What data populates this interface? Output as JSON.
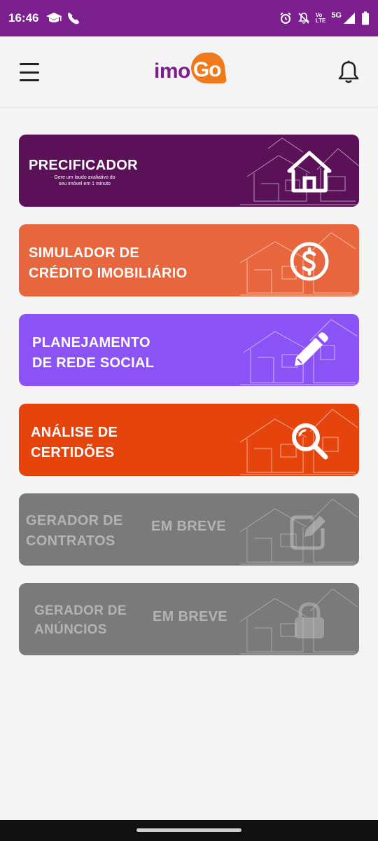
{
  "status_bar": {
    "time": "16:46",
    "network_label": "5G",
    "volte_label": "Vo\nLTE"
  },
  "header": {
    "logo_imo": "imo",
    "logo_go": "Go"
  },
  "colors": {
    "status_bar": "#7b1f8e",
    "brand_purple": "#7b1f8e",
    "brand_orange": "#f07a1a"
  },
  "cards": [
    {
      "title": "PRECIFICADOR",
      "subtitle": "Gere um  laudo avaliativo do\nseu imóvel em  1 minuto",
      "icon": "house-icon",
      "color": "#5a1158",
      "enabled": true
    },
    {
      "title": "SIMULADOR DE\nCRÉDITO IMOBILIÁRIO",
      "icon": "dollar-icon",
      "color": "#e8663d",
      "enabled": true
    },
    {
      "title": "PLANEJAMENTO\nDE REDE SOCIAL",
      "icon": "pencil-icon",
      "color": "#8b52f5",
      "enabled": true
    },
    {
      "title": "ANÁLISE DE\nCERTIDÕES",
      "icon": "magnifier-icon",
      "color": "#e6440d",
      "enabled": true
    },
    {
      "title": "GERADOR DE\nCONTRATOS",
      "soon_label": "EM BREVE",
      "icon": "edit-icon",
      "color": "#7a7a7a",
      "enabled": false
    },
    {
      "title": "GERADOR DE\nANÚNCIOS",
      "soon_label": "EM BREVE",
      "icon": "lock-icon",
      "color": "#7a7a7a",
      "enabled": false
    }
  ]
}
